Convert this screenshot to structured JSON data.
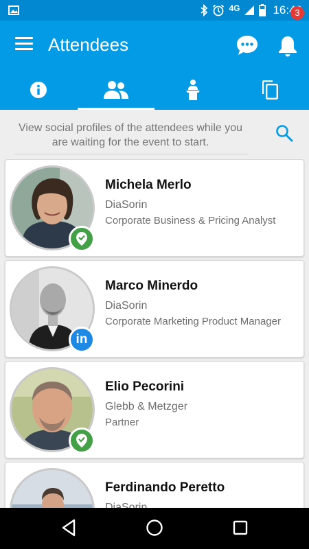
{
  "status_bar": {
    "network": "4G",
    "time": "16:49"
  },
  "app_bar": {
    "title": "Attendees",
    "notification_count": "3"
  },
  "tabs": [
    {
      "icon": "info-icon",
      "active": false
    },
    {
      "icon": "people-icon",
      "active": true
    },
    {
      "icon": "speaker-podium-icon",
      "active": false
    },
    {
      "icon": "copy-icon",
      "active": false
    }
  ],
  "hint": {
    "text": "View social profiles of the attendees while you are waiting for the event to start."
  },
  "attendees": [
    {
      "name": "Michela Merlo",
      "company": "DiaSorin",
      "role": "Corporate Business & Pricing Analyst",
      "badge": "verified-icon"
    },
    {
      "name": "Marco Minerdo",
      "company": "DiaSorin",
      "role": "Corporate Marketing Product Manager",
      "badge": "linkedin-icon",
      "badge_text": "in"
    },
    {
      "name": "Elio Pecorini",
      "company": "Glebb & Metzger",
      "role": "Partner",
      "badge": "verified-icon"
    },
    {
      "name": "Ferdinando Peretto",
      "company": "DiaSorin",
      "role": ""
    }
  ],
  "colors": {
    "primary": "#039be5",
    "status_bar": "#0288d1",
    "verified": "#43a047",
    "linkedin": "#1e88e5",
    "badge": "#e53935"
  }
}
